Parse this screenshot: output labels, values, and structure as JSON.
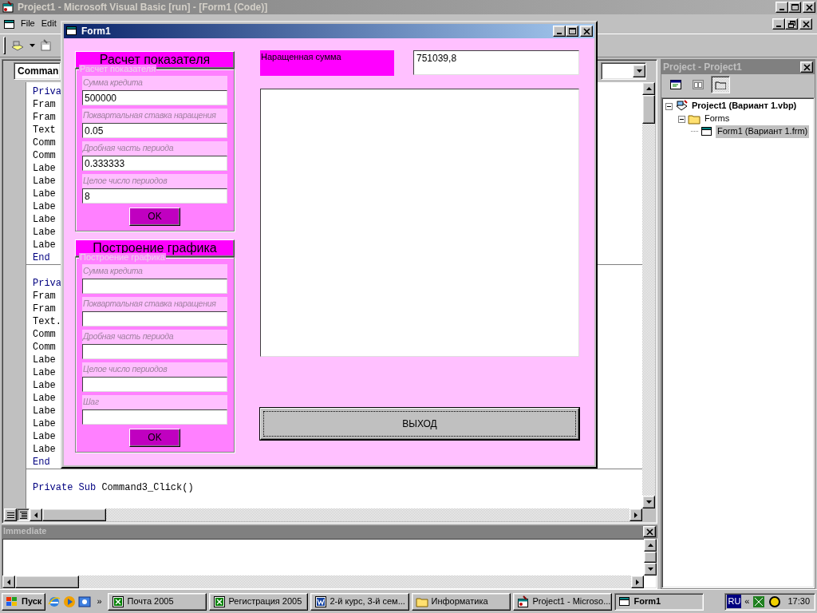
{
  "ide": {
    "title": "Project1 - Microsoft Visual Basic [run] - [Form1 (Code)]",
    "menu": [
      "File",
      "Edit"
    ]
  },
  "code_window": {
    "object_combo": "Comman",
    "sections": [
      {
        "lines": [
          {
            "kind": "keyword",
            "text": "Priva"
          },
          {
            "kind": "plain",
            "text": "Fram"
          },
          {
            "kind": "plain",
            "text": "Fram"
          },
          {
            "kind": "plain",
            "text": "Text"
          },
          {
            "kind": "plain",
            "text": "Comm"
          },
          {
            "kind": "plain",
            "text": "Comm"
          },
          {
            "kind": "plain",
            "text": "Labe"
          },
          {
            "kind": "plain",
            "text": "Labe"
          },
          {
            "kind": "plain",
            "text": "Labe"
          },
          {
            "kind": "plain",
            "text": "Labe"
          },
          {
            "kind": "plain",
            "text": "Labe"
          },
          {
            "kind": "plain",
            "text": "Labe"
          },
          {
            "kind": "plain",
            "text": "Labe"
          },
          {
            "kind": "keyword",
            "text": "End"
          }
        ]
      },
      {
        "lines": [
          {
            "kind": "keyword",
            "text": "Priva"
          },
          {
            "kind": "plain",
            "text": "Fram"
          },
          {
            "kind": "plain",
            "text": "Fram"
          },
          {
            "kind": "plain",
            "text": "Text."
          },
          {
            "kind": "plain",
            "text": "Comm"
          },
          {
            "kind": "plain",
            "text": "Comm"
          },
          {
            "kind": "plain",
            "text": "Labe"
          },
          {
            "kind": "plain",
            "text": "Labe"
          },
          {
            "kind": "plain",
            "text": "Labe"
          },
          {
            "kind": "plain",
            "text": "Labe"
          },
          {
            "kind": "plain",
            "text": "Labe"
          },
          {
            "kind": "plain",
            "text": "Labe"
          },
          {
            "kind": "plain",
            "text": "Labe"
          },
          {
            "kind": "plain",
            "text": "Labe"
          },
          {
            "kind": "keyword",
            "text": "End"
          }
        ]
      },
      {
        "lines": [
          {
            "kind": "mixed",
            "keyword": "Private Sub",
            "text": "Command3_Click()"
          }
        ]
      }
    ]
  },
  "form1": {
    "title": "Form1",
    "panels": [
      {
        "header": "Расчет показателя",
        "frame_caption": "Расчет показателя",
        "fields": [
          {
            "label": "Сумма кредита",
            "value": "500000"
          },
          {
            "label": "Поквартальная ставка наращения",
            "value": "0.05"
          },
          {
            "label": "Дробная часть периода",
            "value": "0.333333"
          },
          {
            "label": "Целое число периодов",
            "value": "8"
          }
        ],
        "button": "OK"
      },
      {
        "header": "Построение графика",
        "frame_caption": "Построение графика",
        "fields": [
          {
            "label": "Сумма кредита"
          },
          {
            "label": "Поквартальная ставка наращения"
          },
          {
            "label": "Дробная часть периода"
          },
          {
            "label": "Целое число периодов"
          },
          {
            "label": "Шаг"
          }
        ],
        "button": "OK"
      }
    ],
    "result_label": "Наращенная сумма",
    "result_value": "751039,8",
    "exit_button": {
      "label": "ВЫХОД",
      "focused": true
    }
  },
  "project_panel": {
    "title": "Project - Project1",
    "toolbar": [
      {
        "kind": "code",
        "pressed": false
      },
      {
        "kind": "object",
        "pressed": false
      },
      {
        "kind": "folders",
        "pressed": true
      }
    ],
    "tree": [
      {
        "label": "Project1 (Вариант 1.vbp)",
        "kind": "project",
        "expanded": true,
        "selected": false,
        "children": [
          {
            "label": "Forms",
            "kind": "folder",
            "expanded": true,
            "selected": false,
            "children": [
              {
                "label": "Form1 (Вариант 1.frm)",
                "kind": "form",
                "selected": true
              }
            ]
          }
        ]
      }
    ]
  },
  "immediate": {
    "title": "Immediate"
  },
  "taskbar": {
    "start": "Пуск",
    "more": "»",
    "tasks": [
      {
        "label": "Почта 2005",
        "kind": "sheet",
        "selected": false
      },
      {
        "label": "Регистрация 2005",
        "kind": "sheet",
        "selected": false
      },
      {
        "label": "2-й курс, 3-й сем...",
        "kind": "document",
        "selected": false
      },
      {
        "label": "Информатика",
        "kind": "folder",
        "selected": false
      },
      {
        "label": "Project1 - Microso...",
        "kind": "program",
        "selected": false
      },
      {
        "label": "Form1",
        "kind": "form",
        "selected": true
      }
    ],
    "language": "RU",
    "expand": "«",
    "clock": "17:30"
  }
}
